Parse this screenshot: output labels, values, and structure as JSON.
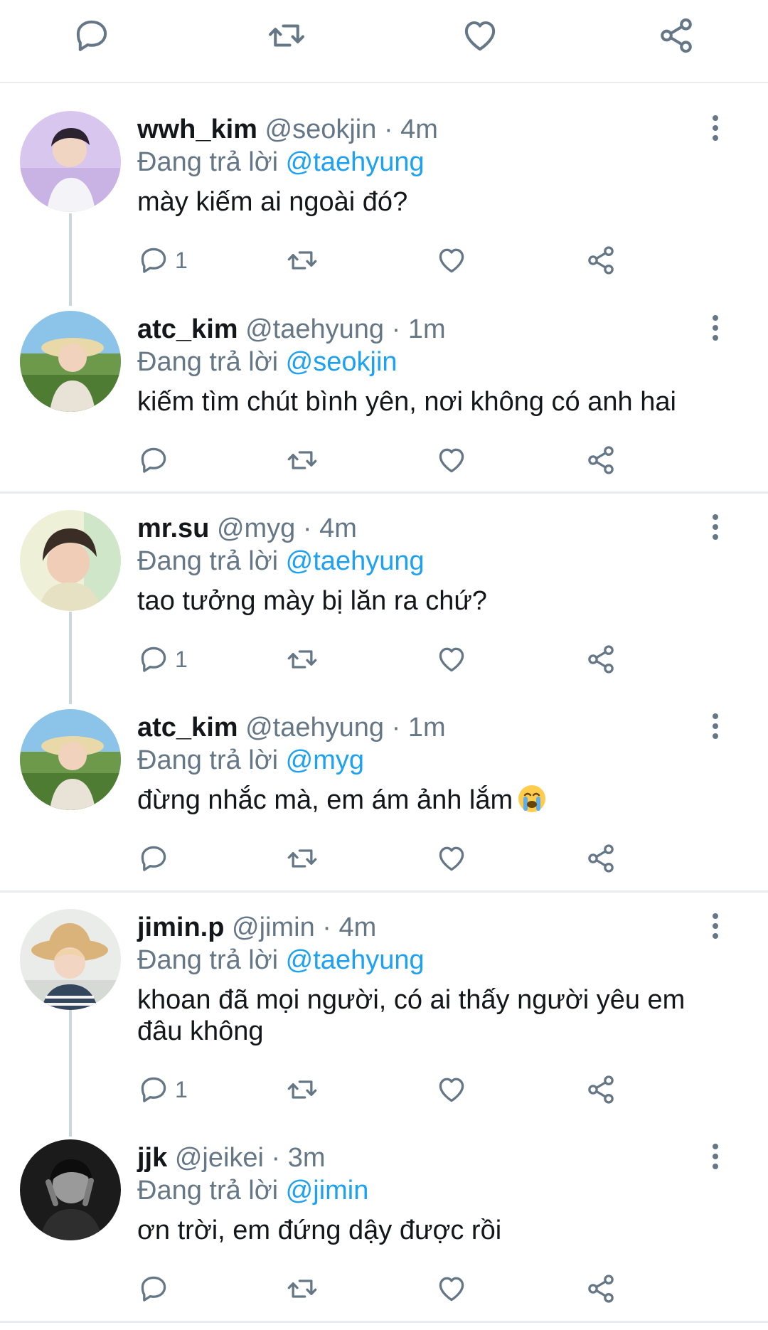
{
  "colors": {
    "accent": "#1da1f2",
    "muted": "#657786",
    "text": "#14171a",
    "divider": "#e6ecf0",
    "thread": "#ccd6dd"
  },
  "top_actions": [
    "reply-icon",
    "retweet-icon",
    "like-icon",
    "share-icon"
  ],
  "tweets": [
    {
      "name": "wwh_kim",
      "handle": "@seokjin",
      "dot": "·",
      "time": "4m",
      "replying_prefix": "Đang trả lời",
      "replying_to": "@taehyung",
      "text": "mày kiếm ai ngoài đó?",
      "reply_count": "1"
    },
    {
      "name": "atc_kim",
      "handle": "@taehyung",
      "dot": "·",
      "time": "1m",
      "replying_prefix": "Đang trả lời",
      "replying_to": "@seokjin",
      "text": "kiếm tìm chút bình yên, nơi không có anh hai",
      "reply_count": ""
    },
    {
      "name": "mr.su",
      "handle": "@myg",
      "dot": "·",
      "time": "4m",
      "replying_prefix": "Đang trả lời",
      "replying_to": "@taehyung",
      "text": "tao tưởng mày bị lăn ra chứ?",
      "reply_count": "1"
    },
    {
      "name": "atc_kim",
      "handle": "@taehyung",
      "dot": "·",
      "time": "1m",
      "replying_prefix": "Đang trả lời",
      "replying_to": "@myg",
      "text": "đừng nhắc mà, em ám ảnh lắm",
      "emoji": "loudly-crying-face-emoji",
      "reply_count": ""
    },
    {
      "name": "jimin.p",
      "handle": "@jimin",
      "dot": "·",
      "time": "4m",
      "replying_prefix": "Đang trả lời",
      "replying_to": "@taehyung",
      "text": "khoan đã mọi người, có ai thấy người yêu em đâu không",
      "reply_count": "1"
    },
    {
      "name": "jjk",
      "handle": "@jeikei",
      "dot": "·",
      "time": "3m",
      "replying_prefix": "Đang trả lời",
      "replying_to": "@jimin",
      "text": "ơn trời, em đứng dậy được rồi",
      "reply_count": ""
    }
  ]
}
